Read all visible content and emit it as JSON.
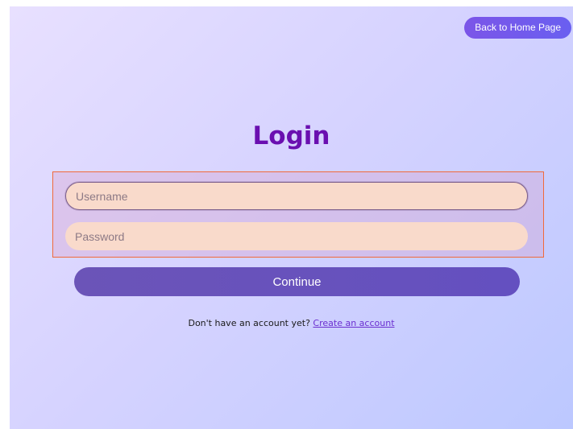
{
  "header": {
    "back_label": "Back to Home Page"
  },
  "page": {
    "title": "Login"
  },
  "form": {
    "username_placeholder": "Username",
    "username_value": "",
    "password_placeholder": "Password",
    "password_value": "",
    "continue_label": "Continue"
  },
  "footer": {
    "prompt": "Don't have an account yet?",
    "create_link": "Create an account"
  },
  "colors": {
    "accent": "#6a0fb0",
    "button": "#6b54b8",
    "field_bg": "#f9dacb",
    "focus_outline": "#f06a3a"
  }
}
